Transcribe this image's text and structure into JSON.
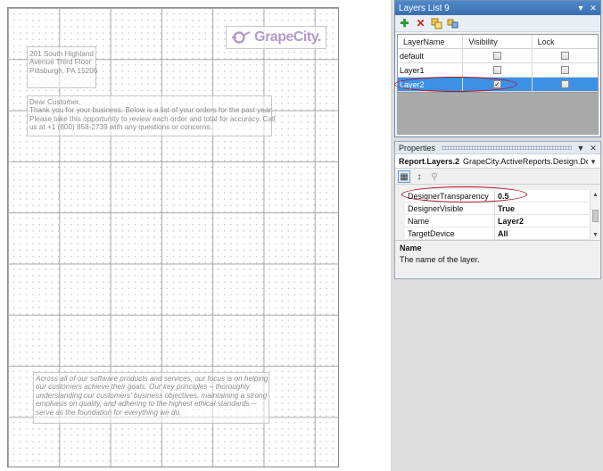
{
  "report": {
    "address_lines": [
      "201 South Highland",
      "Avenue Third Floor",
      "Pittsburgh, PA 15206"
    ],
    "letter_lines": [
      "Dear Customer,",
      "Thank you for your business. Below is a list of your orders for the past year.",
      "Please take this opportunity to review each order and total for accuracy. Call",
      "us at +1 (800) 858-2739 with any questions or concerns."
    ],
    "footer_lines": [
      "Across all of our software products and services, our focus is on helping",
      "our customers achieve their goals. Our key principles – thoroughly",
      "understanding our customers' business objectives, maintaining a strong",
      "emphasis on quality, and adhering to the highest ethical standards –",
      "serve as the foundation for everything we do."
    ],
    "logo_text": "GrapeCity."
  },
  "layers_panel": {
    "title": "Layers List 9",
    "toolbar": {
      "add_icon": "plus-icon",
      "delete_icon": "delete-x-icon",
      "copy_icon": "copy-layer-icon",
      "merge_icon": "merge-layer-icon"
    },
    "columns": [
      "LayerName",
      "Visibility",
      "Lock"
    ],
    "rows": [
      {
        "name": "default",
        "visible": false,
        "locked": false
      },
      {
        "name": "Layer1",
        "visible": false,
        "locked": false
      },
      {
        "name": "Layer2",
        "visible": true,
        "locked": false
      }
    ],
    "selected_row": "Layer2"
  },
  "properties_panel": {
    "title": "Properties",
    "object_name": "Report.Layers.2",
    "object_type": "GrapeCity.ActiveReports.Design.DdrD",
    "properties": [
      {
        "name": "DesignerTransparency",
        "value": "0.5"
      },
      {
        "name": "DesignerVisible",
        "value": "True"
      },
      {
        "name": "Name",
        "value": "Layer2"
      },
      {
        "name": "TargetDevice",
        "value": "All"
      }
    ],
    "description_title": "Name",
    "description_text": "The name of the layer."
  },
  "colors": {
    "accent": "#3c91e6",
    "callout": "#a8172a",
    "logo": "#b39bc9"
  }
}
